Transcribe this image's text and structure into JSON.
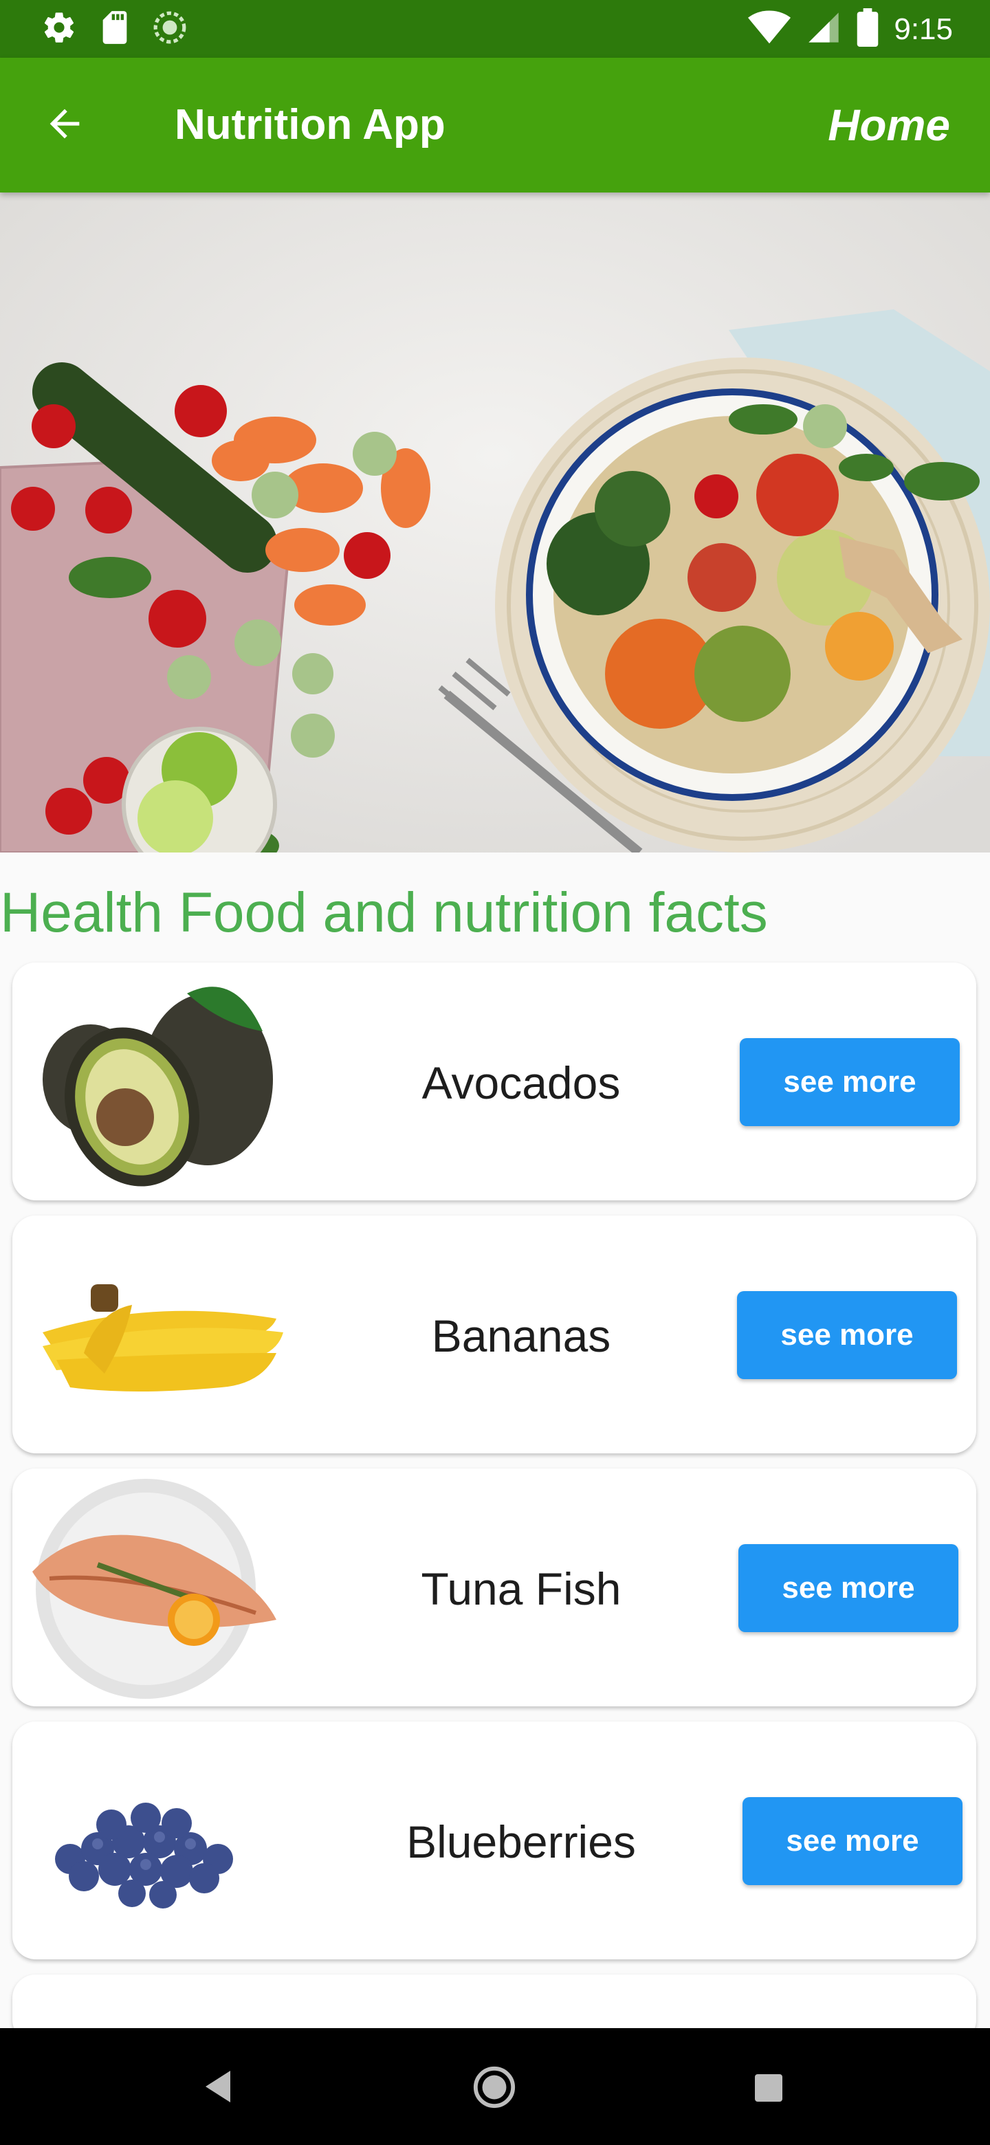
{
  "status_bar": {
    "time": "9:15",
    "left_icons": [
      "gear-icon",
      "sd-card-icon",
      "sync-icon"
    ],
    "right_icons": [
      "wifi-icon",
      "signal-icon",
      "battery-icon"
    ]
  },
  "app_bar": {
    "title": "Nutrition App",
    "home_label": "Home",
    "back_icon": "arrow-left-icon"
  },
  "section_title": "Health Food and nutrition facts",
  "foods": [
    {
      "name": "Avocados",
      "button": "see more"
    },
    {
      "name": "Bananas",
      "button": "see more"
    },
    {
      "name": "Tuna Fish",
      "button": "see more"
    },
    {
      "name": "Blueberries",
      "button": "see more"
    }
  ],
  "nav_bar": [
    "back-triangle-icon",
    "home-circle-icon",
    "recents-square-icon"
  ],
  "colors": {
    "status_bar": "#2d7a0c",
    "app_bar": "#45a20d",
    "section_title": "#4caf50",
    "button": "#2196f3"
  }
}
